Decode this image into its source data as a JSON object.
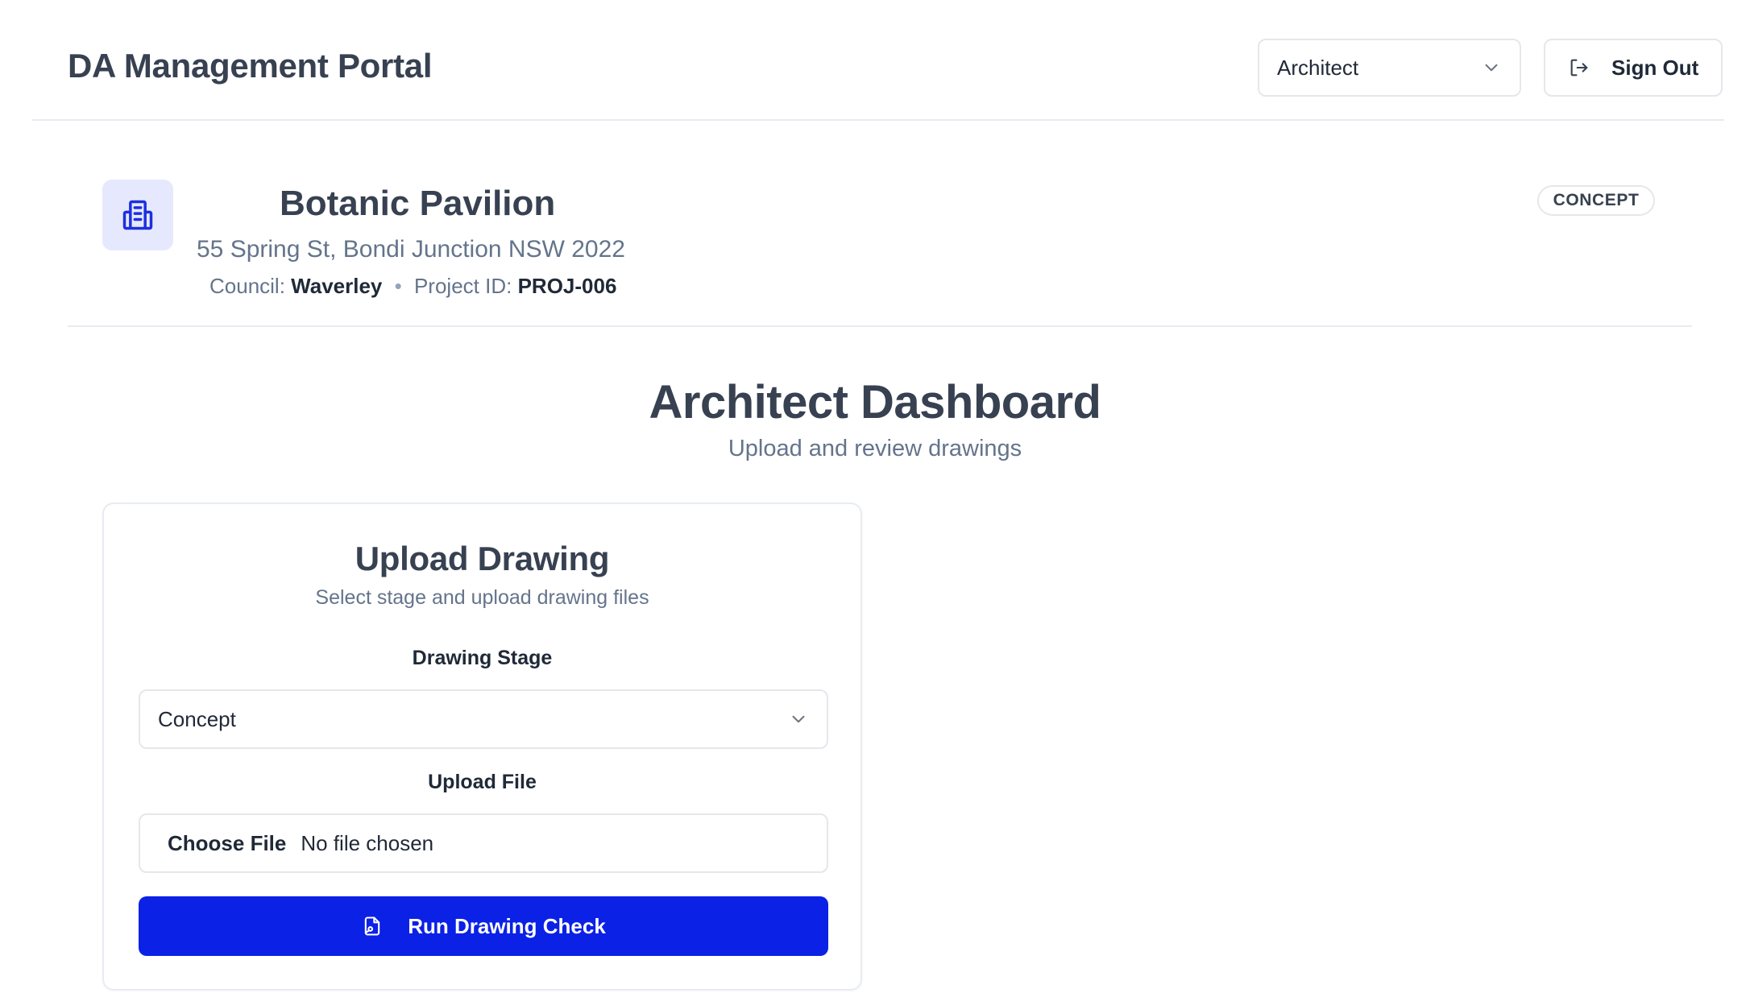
{
  "header": {
    "title": "DA Management Portal",
    "role_select": {
      "value": "Architect",
      "icon": "chevron-down-icon"
    },
    "sign_out": {
      "label": "Sign Out",
      "icon": "log-out-icon"
    }
  },
  "project": {
    "icon": "building-icon",
    "name": "Botanic Pavilion",
    "address": "55 Spring St, Bondi Junction NSW 2022",
    "council_label": "Council:",
    "council": "Waverley",
    "separator": "•",
    "project_id_label": "Project ID:",
    "project_id": "PROJ-006",
    "stage_badge": "CONCEPT"
  },
  "dashboard": {
    "title": "Architect Dashboard",
    "subtitle": "Upload and review drawings"
  },
  "upload_card": {
    "title": "Upload Drawing",
    "subtitle": "Select stage and upload drawing files",
    "stage_label": "Drawing Stage",
    "stage_value": "Concept",
    "file_label": "Upload File",
    "choose_file": "Choose File",
    "file_status": "No file chosen",
    "run_button": "Run Drawing Check",
    "run_icon": "file-check-icon"
  },
  "colors": {
    "primary": "#0b21e6",
    "icon_bg": "#e6e9fd",
    "border": "#e5e7eb",
    "heading": "#374151",
    "muted": "#64748b"
  }
}
